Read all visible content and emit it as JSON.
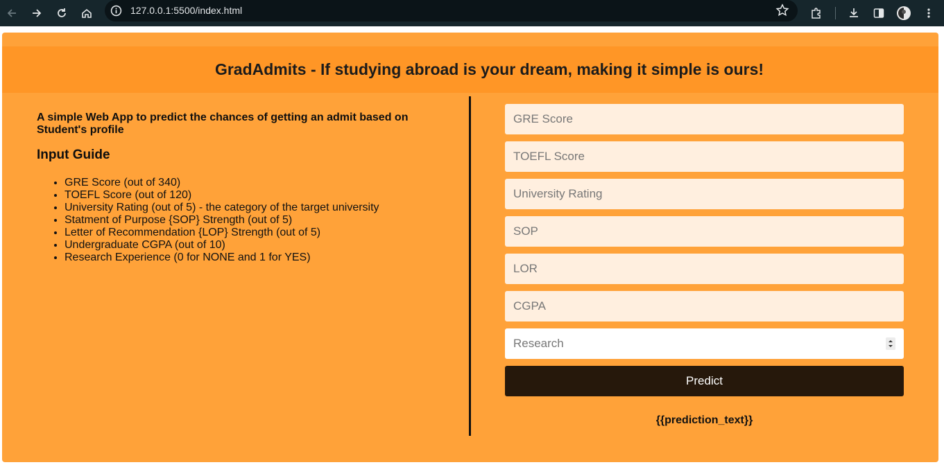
{
  "browser": {
    "url": "127.0.0.1:5500/index.html"
  },
  "page": {
    "header_title": "GradAdmits - If studying abroad is your dream, making it simple is ours!",
    "subtitle": "A simple Web App to predict the chances of getting an admit based on Student's profile",
    "guide_title": "Input Guide",
    "guide_items": [
      "GRE Score (out of 340)",
      "TOEFL Score (out of 120)",
      "University Rating (out of 5) - the category of the target university",
      "Statment of Purpose {SOP} Strength (out of 5)",
      "Letter of Recommendation {LOP} Strength (out of 5)",
      "Undergraduate CGPA (out of 10)",
      "Research Experience (0 for NONE and 1 for YES)"
    ]
  },
  "form": {
    "gre_placeholder": "GRE Score",
    "toefl_placeholder": "TOEFL Score",
    "rating_placeholder": "University Rating",
    "sop_placeholder": "SOP",
    "lor_placeholder": "LOR",
    "cgpa_placeholder": "CGPA",
    "research_placeholder": "Research",
    "predict_label": "Predict",
    "prediction_text": "{{prediction_text}}"
  },
  "colors": {
    "page_bg": "#ffa239",
    "header_bg": "#ff9626",
    "input_bg": "#ffefdf",
    "button_bg": "#26180b"
  }
}
